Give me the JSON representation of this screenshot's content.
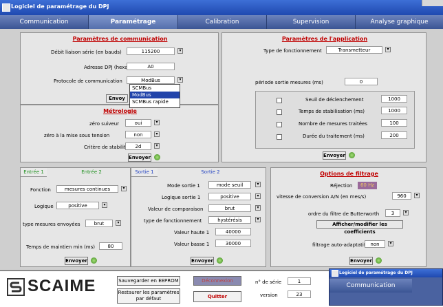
{
  "window": {
    "title": "Logiciel de paramétrage du DPJ"
  },
  "tabs": [
    "Communication",
    "Paramétrage",
    "Calibration",
    "Supervision",
    "Analyse graphique"
  ],
  "communication": {
    "heading": "Paramètres de communication",
    "baud_label": "Débit liaison série (en bauds)",
    "baud_value": "115200",
    "address_label": "Adresse DPJ (hexa)",
    "address_value": "A0",
    "protocol_label": "Protocole de communication",
    "protocol_value": "ModBus",
    "protocol_options": [
      "SCMBus",
      "ModBus",
      "SCMBus rapide"
    ],
    "send_label": "Envoy"
  },
  "metrologie": {
    "heading": "Métrologie",
    "zero_tracker_label": "zéro suiveur",
    "zero_tracker_value": "oui",
    "zero_power_label": "zéro à la mise sous tension",
    "zero_power_value": "non",
    "stability_label": "Critère de stabilité",
    "stability_value": "2d",
    "send_label": "Envoyer"
  },
  "application": {
    "heading": "Paramètres de l'application",
    "mode_label": "Type de fonctionnement",
    "mode_value": "Transmetteur",
    "period_label": "période sortie mesures (ms)",
    "period_value": "0",
    "trigger_label": "Seuil de déclenchement",
    "trigger_value": "1000",
    "stab_time_label": "Temps de stabilisation (ms)",
    "stab_time_value": "1000",
    "count_label": "Nombre de mesures traitées",
    "count_value": "100",
    "duration_label": "Durée du traitement (ms)",
    "duration_value": "200",
    "send_label": "Envoyer"
  },
  "inputs": {
    "tab1": "Entrée 1",
    "tab2": "Entrée 2",
    "function_label": "Fonction",
    "function_value": "mesures continues",
    "logic_label": "Logique",
    "logic_value": "positive",
    "type_label": "type mesures envoyées",
    "type_value": "brut",
    "hold_label": "Temps de maintien min (ms)",
    "hold_value": "80",
    "send_label": "Envoyer"
  },
  "outputs": {
    "tab1": "Sortie 1",
    "tab2": "Sortie 2",
    "mode_label": "Mode sortie 1",
    "mode_value": "mode seuil",
    "logic_label": "Logique sortie 1",
    "logic_value": "positive",
    "compare_label": "Valeur de comparaison",
    "compare_value": "brut",
    "type_label": "type de fonctionnement",
    "type_value": "hystérésis",
    "high_label": "Valeur haute 1",
    "high_value": "40000",
    "low_label": "Valeur basse 1",
    "low_value": "30000",
    "send_label": "Envoyer"
  },
  "filter": {
    "heading": "Options de filtrage",
    "rejection_label": "Réjection",
    "rejection_value": "60 Hz",
    "speed_label": "vitesse de conversion A/N (en mes/s)",
    "speed_value": "960",
    "order_label": "ordre du filtre de Butterworth",
    "order_value": "3",
    "coeff_button": "Afficher/modifier les coefficients",
    "adaptive_label": "filtrage auto-adaptatif",
    "adaptive_value": "non",
    "send_label": "Envoyer"
  },
  "footer": {
    "logo": "SCAIME",
    "save_eeprom": "Sauvegarder en EEPROM",
    "restore_defaults": "Restaurer les paramètres par défaut",
    "disconnect": "Déconnexion",
    "quit": "Quitter",
    "serial_label": "n° de série",
    "serial_value": "1",
    "version_label": "version",
    "version_value": "23"
  },
  "overlay_window": {
    "title": "Logiciel de paramétrage du DPJ",
    "tab": "Communication"
  }
}
